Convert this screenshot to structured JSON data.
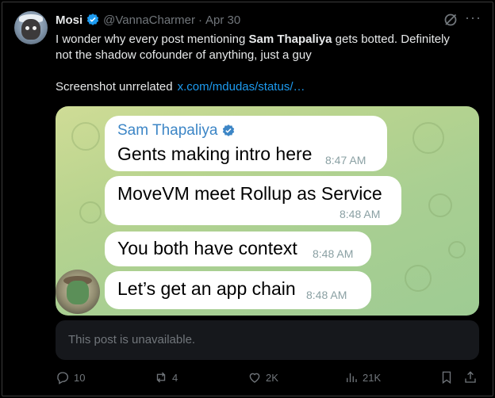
{
  "post": {
    "author_name": "Mosi",
    "handle": "@VannaCharmer",
    "separator": "·",
    "date": "Apr 30",
    "more_label": "···",
    "text_line1_a": "I wonder why every post mentioning ",
    "text_line1_bold": "Sam Thapaliya",
    "text_line1_b": " gets botted. Definitely",
    "text_line2": "not the shadow cofounder of anything, just a guy",
    "text_para2": "Screenshot unrrelated",
    "link": "x.com/mdudas/status/…"
  },
  "telegram": {
    "sender": "Sam Thapaliya",
    "messages": [
      {
        "text": "Gents making intro here",
        "time": "8:47 AM"
      },
      {
        "text": "MoveVM meet Rollup as Service",
        "time": "8:48 AM"
      },
      {
        "text": "You both have context",
        "time": "8:48 AM"
      },
      {
        "text": "Let’s get an app chain",
        "time": "8:48 AM"
      }
    ]
  },
  "quote": {
    "unavailable": "This post is unavailable."
  },
  "actions": {
    "replies": "10",
    "reposts": "4",
    "likes": "2K",
    "views": "21K"
  },
  "colors": {
    "background": "#000000",
    "text": "#e7e9ea",
    "muted": "#71767b",
    "link": "#1d9bf0",
    "verified": "#1d9bf0",
    "telegram_sender": "#3d86c6"
  }
}
